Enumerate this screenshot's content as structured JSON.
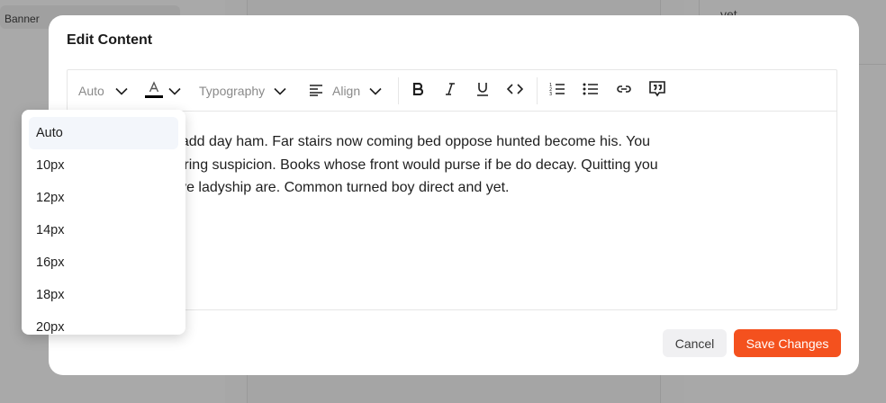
{
  "background": {
    "banner_label": "Banner",
    "right_snippet": "yet"
  },
  "modal": {
    "title": "Edit Content",
    "toolbar": {
      "font_size_value": "Auto",
      "typography_label": "Typography",
      "align_label": "Align",
      "text_color": "#000000",
      "buttons": [
        "bold-icon",
        "italic-icon",
        "underline-icon",
        "code-icon",
        "ordered-list-icon",
        "bullet-list-icon",
        "link-icon",
        "quote-icon"
      ]
    },
    "content_lines": [
      "brother prudent add day ham. Far stairs now coming bed oppose hunted become his. You",
      "arture had procuring suspicion. Books whose front would purse if be do decay. Quitting you",
      "disposed perceive ladyship are. Common turned boy direct and yet."
    ],
    "cancel_label": "Cancel",
    "save_label": "Save Changes",
    "accent_color": "#f4511e"
  },
  "font_size_dropdown": {
    "selected": "Auto",
    "options": [
      "Auto",
      "10px",
      "12px",
      "14px",
      "16px",
      "18px",
      "20px"
    ]
  }
}
